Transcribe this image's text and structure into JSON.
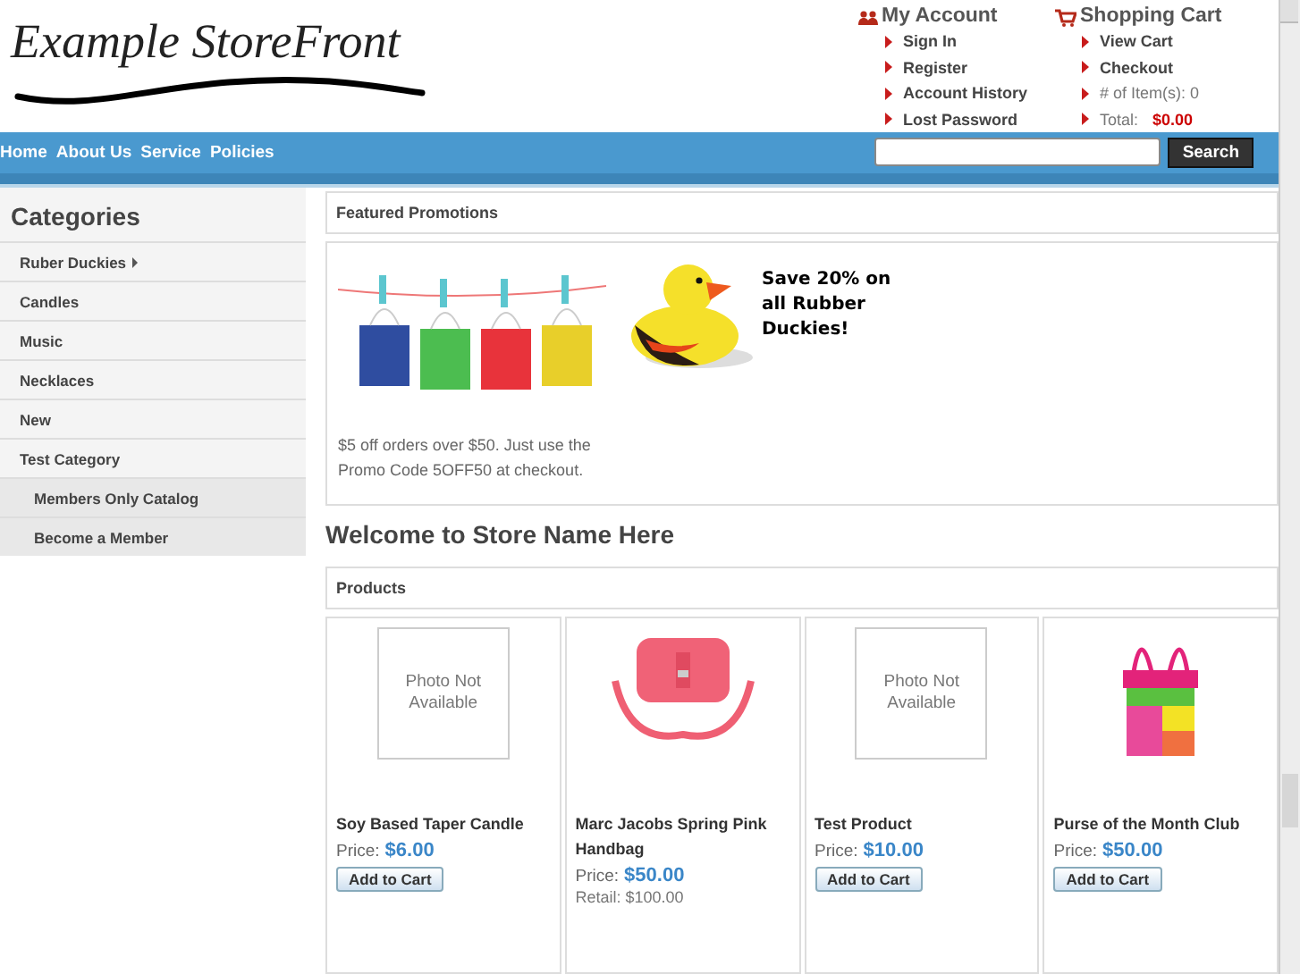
{
  "logo": {
    "text": "Example StoreFront"
  },
  "account": {
    "title": "My Account",
    "links": [
      "Sign In",
      "Register",
      "Account History",
      "Lost Password"
    ]
  },
  "cart": {
    "title": "Shopping Cart",
    "links": [
      "View Cart",
      "Checkout"
    ],
    "items_label": "# of Item(s): 0",
    "total_label": "Total:",
    "total": "$0.00"
  },
  "nav": [
    "Home",
    "About Us",
    "Service",
    "Policies"
  ],
  "search": {
    "button": "Search"
  },
  "sidebar": {
    "title": "Categories",
    "items": [
      {
        "label": "Ruber Duckies",
        "has_children": true,
        "kind": "category"
      },
      {
        "label": "Candles",
        "has_children": false,
        "kind": "category"
      },
      {
        "label": "Music",
        "has_children": false,
        "kind": "category"
      },
      {
        "label": "Necklaces",
        "has_children": false,
        "kind": "category"
      },
      {
        "label": "New",
        "has_children": false,
        "kind": "category"
      },
      {
        "label": "Test Category",
        "has_children": false,
        "kind": "category"
      },
      {
        "label": "Members Only Catalog",
        "has_children": false,
        "kind": "member"
      },
      {
        "label": "Become a Member",
        "has_children": false,
        "kind": "member"
      }
    ]
  },
  "promotions": {
    "title": "Featured Promotions",
    "text": "$5 off orders over $50. Just use the Promo Code 5OFF50 at checkout.",
    "banner": "Save 20% on all Rubber Duckies!"
  },
  "welcome": "Welcome to Store Name Here",
  "products": {
    "title": "Products",
    "items": [
      {
        "name": "Soy Based Taper Candle",
        "placeholder": "Photo Not Available",
        "price_label": "Price:",
        "price": "$6.00",
        "button": "Add to Cart"
      },
      {
        "name": "Marc Jacobs Spring Pink Handbag",
        "price_label": "Price:",
        "price": "$50.00",
        "retail": "Retail: $100.00"
      },
      {
        "name": "Test Product",
        "placeholder": "Photo Not Available",
        "price_label": "Price:",
        "price": "$10.00",
        "button": "Add to Cart"
      },
      {
        "name": "Purse of the Month Club",
        "price_label": "Price:",
        "price": "$50.00",
        "button": "Add to Cart"
      }
    ]
  }
}
